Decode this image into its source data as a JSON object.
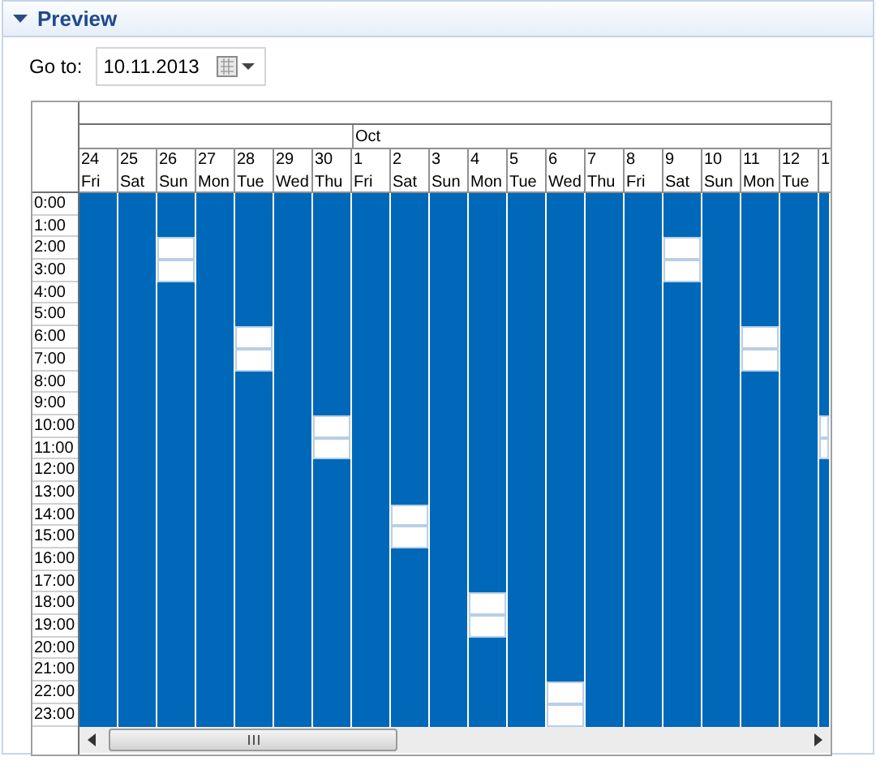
{
  "section": {
    "title": "Preview",
    "expanded": true
  },
  "goto": {
    "label": "Go to:",
    "value": "10.11.2013"
  },
  "hours": [
    "0:00",
    "1:00",
    "2:00",
    "3:00",
    "4:00",
    "5:00",
    "6:00",
    "7:00",
    "8:00",
    "9:00",
    "10:00",
    "11:00",
    "12:00",
    "13:00",
    "14:00",
    "15:00",
    "16:00",
    "17:00",
    "18:00",
    "19:00",
    "20:00",
    "21:00",
    "22:00",
    "23:00"
  ],
  "days": [
    {
      "number": "24",
      "weekday": "Fri",
      "available": [
        false,
        false,
        false,
        false,
        false,
        false,
        false,
        false,
        false,
        false,
        false,
        false,
        false,
        false,
        false,
        false,
        false,
        false,
        false,
        false,
        false,
        false,
        false,
        false
      ]
    },
    {
      "number": "25",
      "weekday": "Sat",
      "available": [
        false,
        false,
        false,
        false,
        false,
        false,
        false,
        false,
        false,
        false,
        false,
        false,
        false,
        false,
        false,
        false,
        false,
        false,
        false,
        false,
        false,
        false,
        false,
        false
      ]
    },
    {
      "number": "26",
      "weekday": "Sun",
      "available": [
        false,
        false,
        true,
        true,
        false,
        false,
        false,
        false,
        false,
        false,
        false,
        false,
        false,
        false,
        false,
        false,
        false,
        false,
        false,
        false,
        false,
        false,
        false,
        false
      ]
    },
    {
      "number": "27",
      "weekday": "Mon",
      "available": [
        false,
        false,
        false,
        false,
        false,
        false,
        false,
        false,
        false,
        false,
        false,
        false,
        false,
        false,
        false,
        false,
        false,
        false,
        false,
        false,
        false,
        false,
        false,
        false
      ]
    },
    {
      "number": "28",
      "weekday": "Tue",
      "available": [
        false,
        false,
        false,
        false,
        false,
        false,
        true,
        true,
        false,
        false,
        false,
        false,
        false,
        false,
        false,
        false,
        false,
        false,
        false,
        false,
        false,
        false,
        false,
        false
      ]
    },
    {
      "number": "29",
      "weekday": "Wed",
      "available": [
        false,
        false,
        false,
        false,
        false,
        false,
        false,
        false,
        false,
        false,
        false,
        false,
        false,
        false,
        false,
        false,
        false,
        false,
        false,
        false,
        false,
        false,
        false,
        false
      ]
    },
    {
      "number": "30",
      "weekday": "Thu",
      "available": [
        false,
        false,
        false,
        false,
        false,
        false,
        false,
        false,
        false,
        false,
        true,
        true,
        false,
        false,
        false,
        false,
        false,
        false,
        false,
        false,
        false,
        false,
        false,
        false
      ]
    },
    {
      "number": "1",
      "weekday": "Fri",
      "month": "Oct",
      "available": [
        false,
        false,
        false,
        false,
        false,
        false,
        false,
        false,
        false,
        false,
        false,
        false,
        false,
        false,
        false,
        false,
        false,
        false,
        false,
        false,
        false,
        false,
        false,
        false
      ]
    },
    {
      "number": "2",
      "weekday": "Sat",
      "available": [
        false,
        false,
        false,
        false,
        false,
        false,
        false,
        false,
        false,
        false,
        false,
        false,
        false,
        false,
        true,
        true,
        false,
        false,
        false,
        false,
        false,
        false,
        false,
        false
      ]
    },
    {
      "number": "3",
      "weekday": "Sun",
      "available": [
        false,
        false,
        false,
        false,
        false,
        false,
        false,
        false,
        false,
        false,
        false,
        false,
        false,
        false,
        false,
        false,
        false,
        false,
        false,
        false,
        false,
        false,
        false,
        false
      ]
    },
    {
      "number": "4",
      "weekday": "Mon",
      "available": [
        false,
        false,
        false,
        false,
        false,
        false,
        false,
        false,
        false,
        false,
        false,
        false,
        false,
        false,
        false,
        false,
        false,
        false,
        true,
        true,
        false,
        false,
        false,
        false
      ]
    },
    {
      "number": "5",
      "weekday": "Tue",
      "available": [
        false,
        false,
        false,
        false,
        false,
        false,
        false,
        false,
        false,
        false,
        false,
        false,
        false,
        false,
        false,
        false,
        false,
        false,
        false,
        false,
        false,
        false,
        false,
        false
      ]
    },
    {
      "number": "6",
      "weekday": "Wed",
      "available": [
        false,
        false,
        false,
        false,
        false,
        false,
        false,
        false,
        false,
        false,
        false,
        false,
        false,
        false,
        false,
        false,
        false,
        false,
        false,
        false,
        false,
        false,
        true,
        true
      ]
    },
    {
      "number": "7",
      "weekday": "Thu",
      "available": [
        false,
        false,
        false,
        false,
        false,
        false,
        false,
        false,
        false,
        false,
        false,
        false,
        false,
        false,
        false,
        false,
        false,
        false,
        false,
        false,
        false,
        false,
        false,
        false
      ]
    },
    {
      "number": "8",
      "weekday": "Fri",
      "available": [
        false,
        false,
        false,
        false,
        false,
        false,
        false,
        false,
        false,
        false,
        false,
        false,
        false,
        false,
        false,
        false,
        false,
        false,
        false,
        false,
        false,
        false,
        false,
        false
      ]
    },
    {
      "number": "9",
      "weekday": "Sat",
      "available": [
        false,
        false,
        true,
        true,
        false,
        false,
        false,
        false,
        false,
        false,
        false,
        false,
        false,
        false,
        false,
        false,
        false,
        false,
        false,
        false,
        false,
        false,
        false,
        false
      ]
    },
    {
      "number": "10",
      "weekday": "Sun",
      "available": [
        false,
        false,
        false,
        false,
        false,
        false,
        false,
        false,
        false,
        false,
        false,
        false,
        false,
        false,
        false,
        false,
        false,
        false,
        false,
        false,
        false,
        false,
        false,
        false
      ]
    },
    {
      "number": "11",
      "weekday": "Mon",
      "available": [
        false,
        false,
        false,
        false,
        false,
        false,
        true,
        true,
        false,
        false,
        false,
        false,
        false,
        false,
        false,
        false,
        false,
        false,
        false,
        false,
        false,
        false,
        false,
        false
      ]
    },
    {
      "number": "12",
      "weekday": "Tue",
      "available": [
        false,
        false,
        false,
        false,
        false,
        false,
        false,
        false,
        false,
        false,
        false,
        false,
        false,
        false,
        false,
        false,
        false,
        false,
        false,
        false,
        false,
        false,
        false,
        false
      ]
    },
    {
      "number": "1",
      "partial": true,
      "available": [
        false,
        false,
        false,
        false,
        false,
        false,
        false,
        false,
        false,
        false,
        true,
        true,
        false,
        false,
        false,
        false,
        false,
        false,
        false,
        false,
        false,
        false,
        false,
        false
      ]
    }
  ]
}
